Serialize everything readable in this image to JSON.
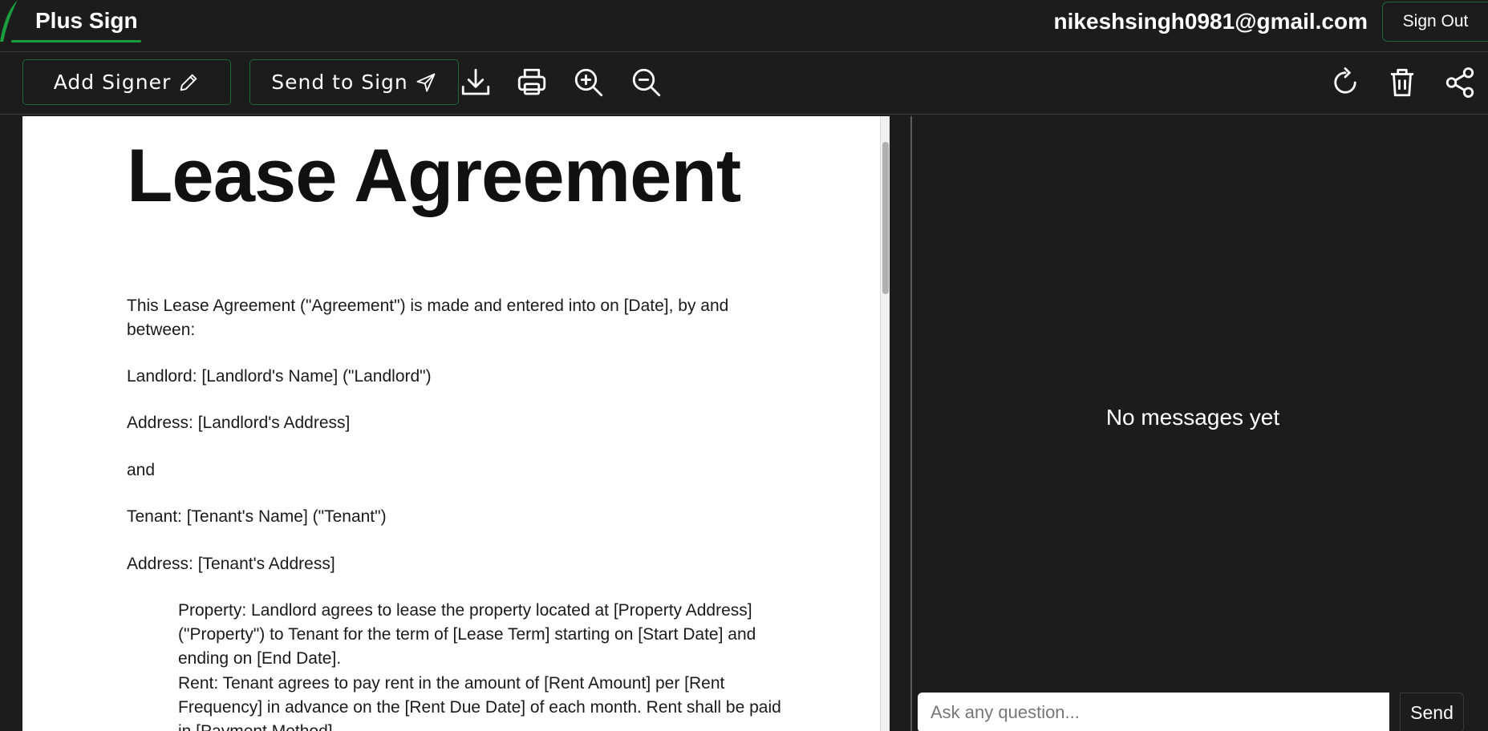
{
  "header": {
    "brand": "Plus Sign",
    "user_email": "nikeshsingh0981@gmail.com",
    "sign_out_label": "Sign Out",
    "accent_color": "#1b9e3e"
  },
  "toolbar": {
    "add_signer_label": "Add Signer",
    "send_to_sign_label": "Send to Sign",
    "icons": [
      "download-icon",
      "print-icon",
      "zoom-in-icon",
      "zoom-out-icon",
      "refresh-icon",
      "trash-icon",
      "share-icon"
    ]
  },
  "document": {
    "title": "Lease Agreement",
    "intro": "This Lease Agreement (\"Agreement\") is made and entered into on [Date], by and between:",
    "landlord": "Landlord: [Landlord's Name] (\"Landlord\")",
    "landlord_address": "Address: [Landlord's Address]",
    "and": "and",
    "tenant": "Tenant: [Tenant's Name] (\"Tenant\")",
    "tenant_address": "Address: [Tenant's Address]",
    "property": "Property: Landlord agrees to lease the property located at [Property Address] (\"Property\") to Tenant for the term of [Lease Term] starting on [Start Date] and ending on [End Date].",
    "rent": "Rent: Tenant agrees to pay rent in the amount of [Rent Amount] per [Rent Frequency] in advance on the [Rent Due Date] of each month. Rent shall be paid in [Payment Method]."
  },
  "chat": {
    "empty_text": "No messages yet",
    "input_placeholder": "Ask any question...",
    "send_label": "Send"
  }
}
